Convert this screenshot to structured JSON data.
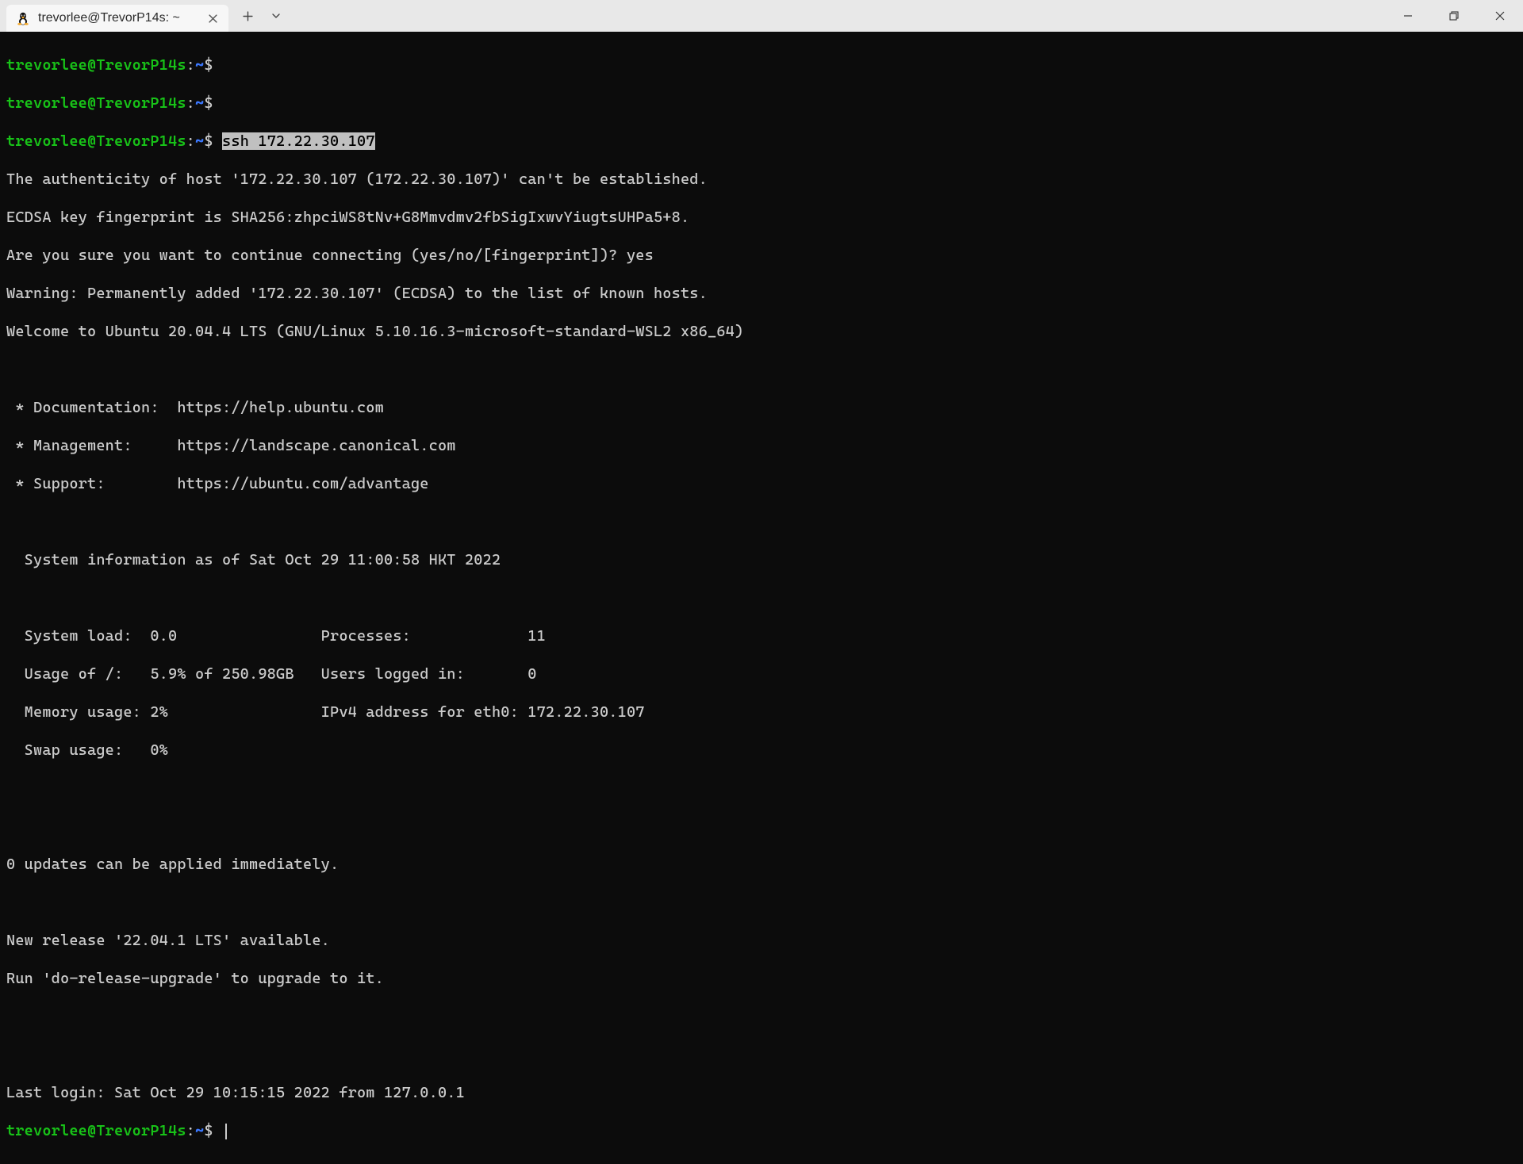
{
  "window": {
    "tab_title": "trevorlee@TrevorP14s: ~"
  },
  "colors": {
    "prompt_user": "#18c218",
    "prompt_path": "#3b78ff",
    "terminal_bg": "#0c0c0c",
    "terminal_fg": "#cccccc",
    "titlebar_bg": "#e8e8e8",
    "tab_bg": "#f7f7f7"
  },
  "prompt": {
    "userhost": "trevorlee@TrevorP14s",
    "colon": ":",
    "path": "~",
    "dollar": "$"
  },
  "term": {
    "cmd_selected": "ssh 172.22.30.107",
    "l_auth": "The authenticity of host '172.22.30.107 (172.22.30.107)' can't be established.",
    "l_fp": "ECDSA key fingerprint is SHA256:zhpciWS8tNv+G8Mmvdmv2fbSigIxwvYiugtsUHPa5+8.",
    "l_cont": "Are you sure you want to continue connecting (yes/no/[fingerprint])? yes",
    "l_warn": "Warning: Permanently added '172.22.30.107' (ECDSA) to the list of known hosts.",
    "l_welcome": "Welcome to Ubuntu 20.04.4 LTS (GNU/Linux 5.10.16.3-microsoft-standard-WSL2 x86_64)",
    "l_doc": " * Documentation:  https://help.ubuntu.com",
    "l_mgmt": " * Management:     https://landscape.canonical.com",
    "l_supp": " * Support:        https://ubuntu.com/advantage",
    "l_sysinfo_hdr": "  System information as of Sat Oct 29 11:00:58 HKT 2022",
    "l_row1": "  System load:  0.0                Processes:             11",
    "l_row2": "  Usage of /:   5.9% of 250.98GB   Users logged in:       0",
    "l_row3": "  Memory usage: 2%                 IPv4 address for eth0: 172.22.30.107",
    "l_row4": "  Swap usage:   0%",
    "l_updates": "0 updates can be applied immediately.",
    "l_newrel": "New release '22.04.1 LTS' available.",
    "l_upgrade": "Run 'do-release-upgrade' to upgrade to it.",
    "l_lastlogin": "Last login: Sat Oct 29 10:15:15 2022 from 127.0.0.1"
  },
  "sysinfo": {
    "timestamp": "Sat Oct 29 11:00:58 HKT 2022",
    "system_load": "0.0",
    "processes": 11,
    "usage_of_root": "5.9% of 250.98GB",
    "users_logged_in": 0,
    "memory_usage": "2%",
    "ipv4_eth0": "172.22.30.107",
    "swap_usage": "0%",
    "updates_applicable": 0,
    "new_release": "22.04.1 LTS",
    "last_login": "Sat Oct 29 10:15:15 2022",
    "last_login_from": "127.0.0.1"
  }
}
